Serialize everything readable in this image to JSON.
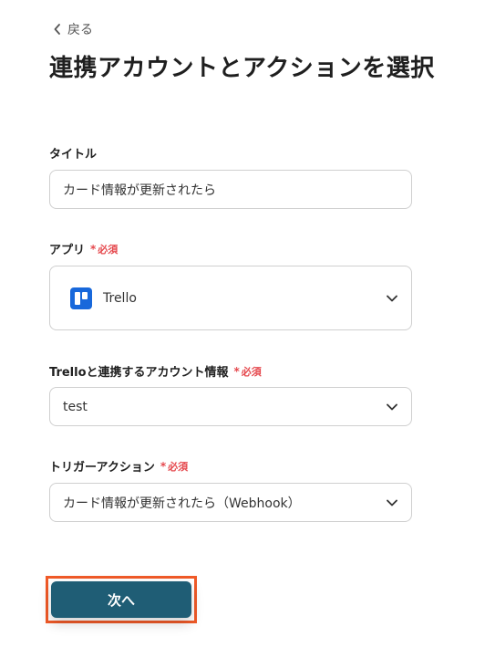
{
  "header": {
    "back_label": "戻る",
    "title": "連携アカウントとアクションを選択"
  },
  "form": {
    "title_field": {
      "label": "タイトル",
      "value": "カード情報が更新されたら"
    },
    "app_field": {
      "label": "アプリ",
      "required_mark": "*",
      "required_text": "必須",
      "value": "Trello",
      "icon": "trello-icon"
    },
    "account_field": {
      "label": "Trelloと連携するアカウント情報",
      "required_mark": "*",
      "required_text": "必須",
      "value": "test"
    },
    "trigger_field": {
      "label": "トリガーアクション",
      "required_mark": "*",
      "required_text": "必須",
      "value": "カード情報が更新されたら（Webhook）"
    }
  },
  "footer": {
    "next_label": "次へ"
  },
  "colors": {
    "primary_button": "#1f5d75",
    "highlight_border": "#f05a28",
    "required": "#e5484d",
    "trello_brand": "#1868db"
  }
}
